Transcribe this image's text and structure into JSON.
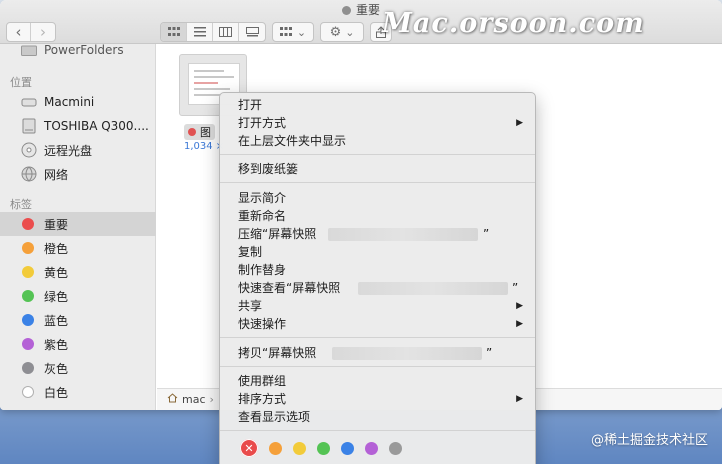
{
  "window": {
    "title": "重要",
    "watermark": "Mac.orsoon.com"
  },
  "toolbar": {
    "back": "‹",
    "forward": "›",
    "view_icon_names": [
      "icon-view-icon",
      "list-view-icon",
      "column-view-icon",
      "gallery-view-icon"
    ],
    "group_icon": "group-by-icon",
    "action_icon": "gear-icon",
    "share_icon": "share-icon",
    "chevron": "⌄"
  },
  "sidebar": {
    "partial_item": "PowerFolders",
    "locations_heading": "位置",
    "locations": [
      {
        "label": "Macmini",
        "icon": "computer-icon"
      },
      {
        "label": "TOSHIBA Q300....",
        "icon": "drive-icon"
      },
      {
        "label": "远程光盘",
        "icon": "disc-icon"
      },
      {
        "label": "网络",
        "icon": "network-icon"
      }
    ],
    "tags_heading": "标签",
    "tags": [
      {
        "label": "重要",
        "color": "#eb4d4d",
        "selected": true
      },
      {
        "label": "橙色",
        "color": "#f5a03a",
        "selected": false
      },
      {
        "label": "黄色",
        "color": "#f2cb3a",
        "selected": false
      },
      {
        "label": "绿色",
        "color": "#54c354",
        "selected": false
      },
      {
        "label": "蓝色",
        "color": "#3b82e6",
        "selected": false
      },
      {
        "label": "紫色",
        "color": "#b461d6",
        "selected": false
      },
      {
        "label": "灰色",
        "color": "#8e8e93",
        "selected": false
      },
      {
        "label": "白色",
        "color": "#ffffff",
        "selected": false
      }
    ]
  },
  "content": {
    "file": {
      "name_partial": "图",
      "size_partial": "1,034 ×"
    },
    "pathbar": {
      "label": "mac",
      "sep": "›",
      "icon": "home-icon"
    }
  },
  "context_menu": {
    "items": [
      {
        "label": "打开",
        "submenu": false,
        "group": 1
      },
      {
        "label": "打开方式",
        "submenu": true,
        "group": 1
      },
      {
        "label": "在上层文件夹中显示",
        "submenu": false,
        "group": 1
      },
      {
        "label": "移到废纸篓",
        "submenu": false,
        "group": 2
      },
      {
        "label": "显示简介",
        "submenu": false,
        "group": 3
      },
      {
        "label": "重新命名",
        "submenu": false,
        "group": 3
      },
      {
        "label": "压缩“屏幕快照",
        "suffix": "”",
        "submenu": false,
        "group": 3
      },
      {
        "label": "复制",
        "submenu": false,
        "group": 3
      },
      {
        "label": "制作替身",
        "submenu": false,
        "group": 3
      },
      {
        "label": "快速查看“屏幕快照",
        "suffix": "”",
        "submenu": false,
        "group": 3
      },
      {
        "label": "共享",
        "submenu": true,
        "group": 3
      },
      {
        "label": "快速操作",
        "submenu": true,
        "group": 3
      },
      {
        "label": "拷贝“屏幕快照",
        "suffix": "”",
        "submenu": false,
        "group": 4
      },
      {
        "label": "使用群组",
        "submenu": false,
        "group": 5
      },
      {
        "label": "排序方式",
        "submenu": true,
        "group": 5
      },
      {
        "label": "查看显示选项",
        "submenu": false,
        "group": 5
      }
    ],
    "submenu_arrow": "▶",
    "tag_colors": [
      "#e94b4b",
      "#f5a03a",
      "#f2cb3a",
      "#54c354",
      "#3b82e6",
      "#b461d6",
      "#9a9a9a"
    ],
    "remove_tag_glyph": "✕"
  },
  "credit": "@稀土掘金技术社区"
}
